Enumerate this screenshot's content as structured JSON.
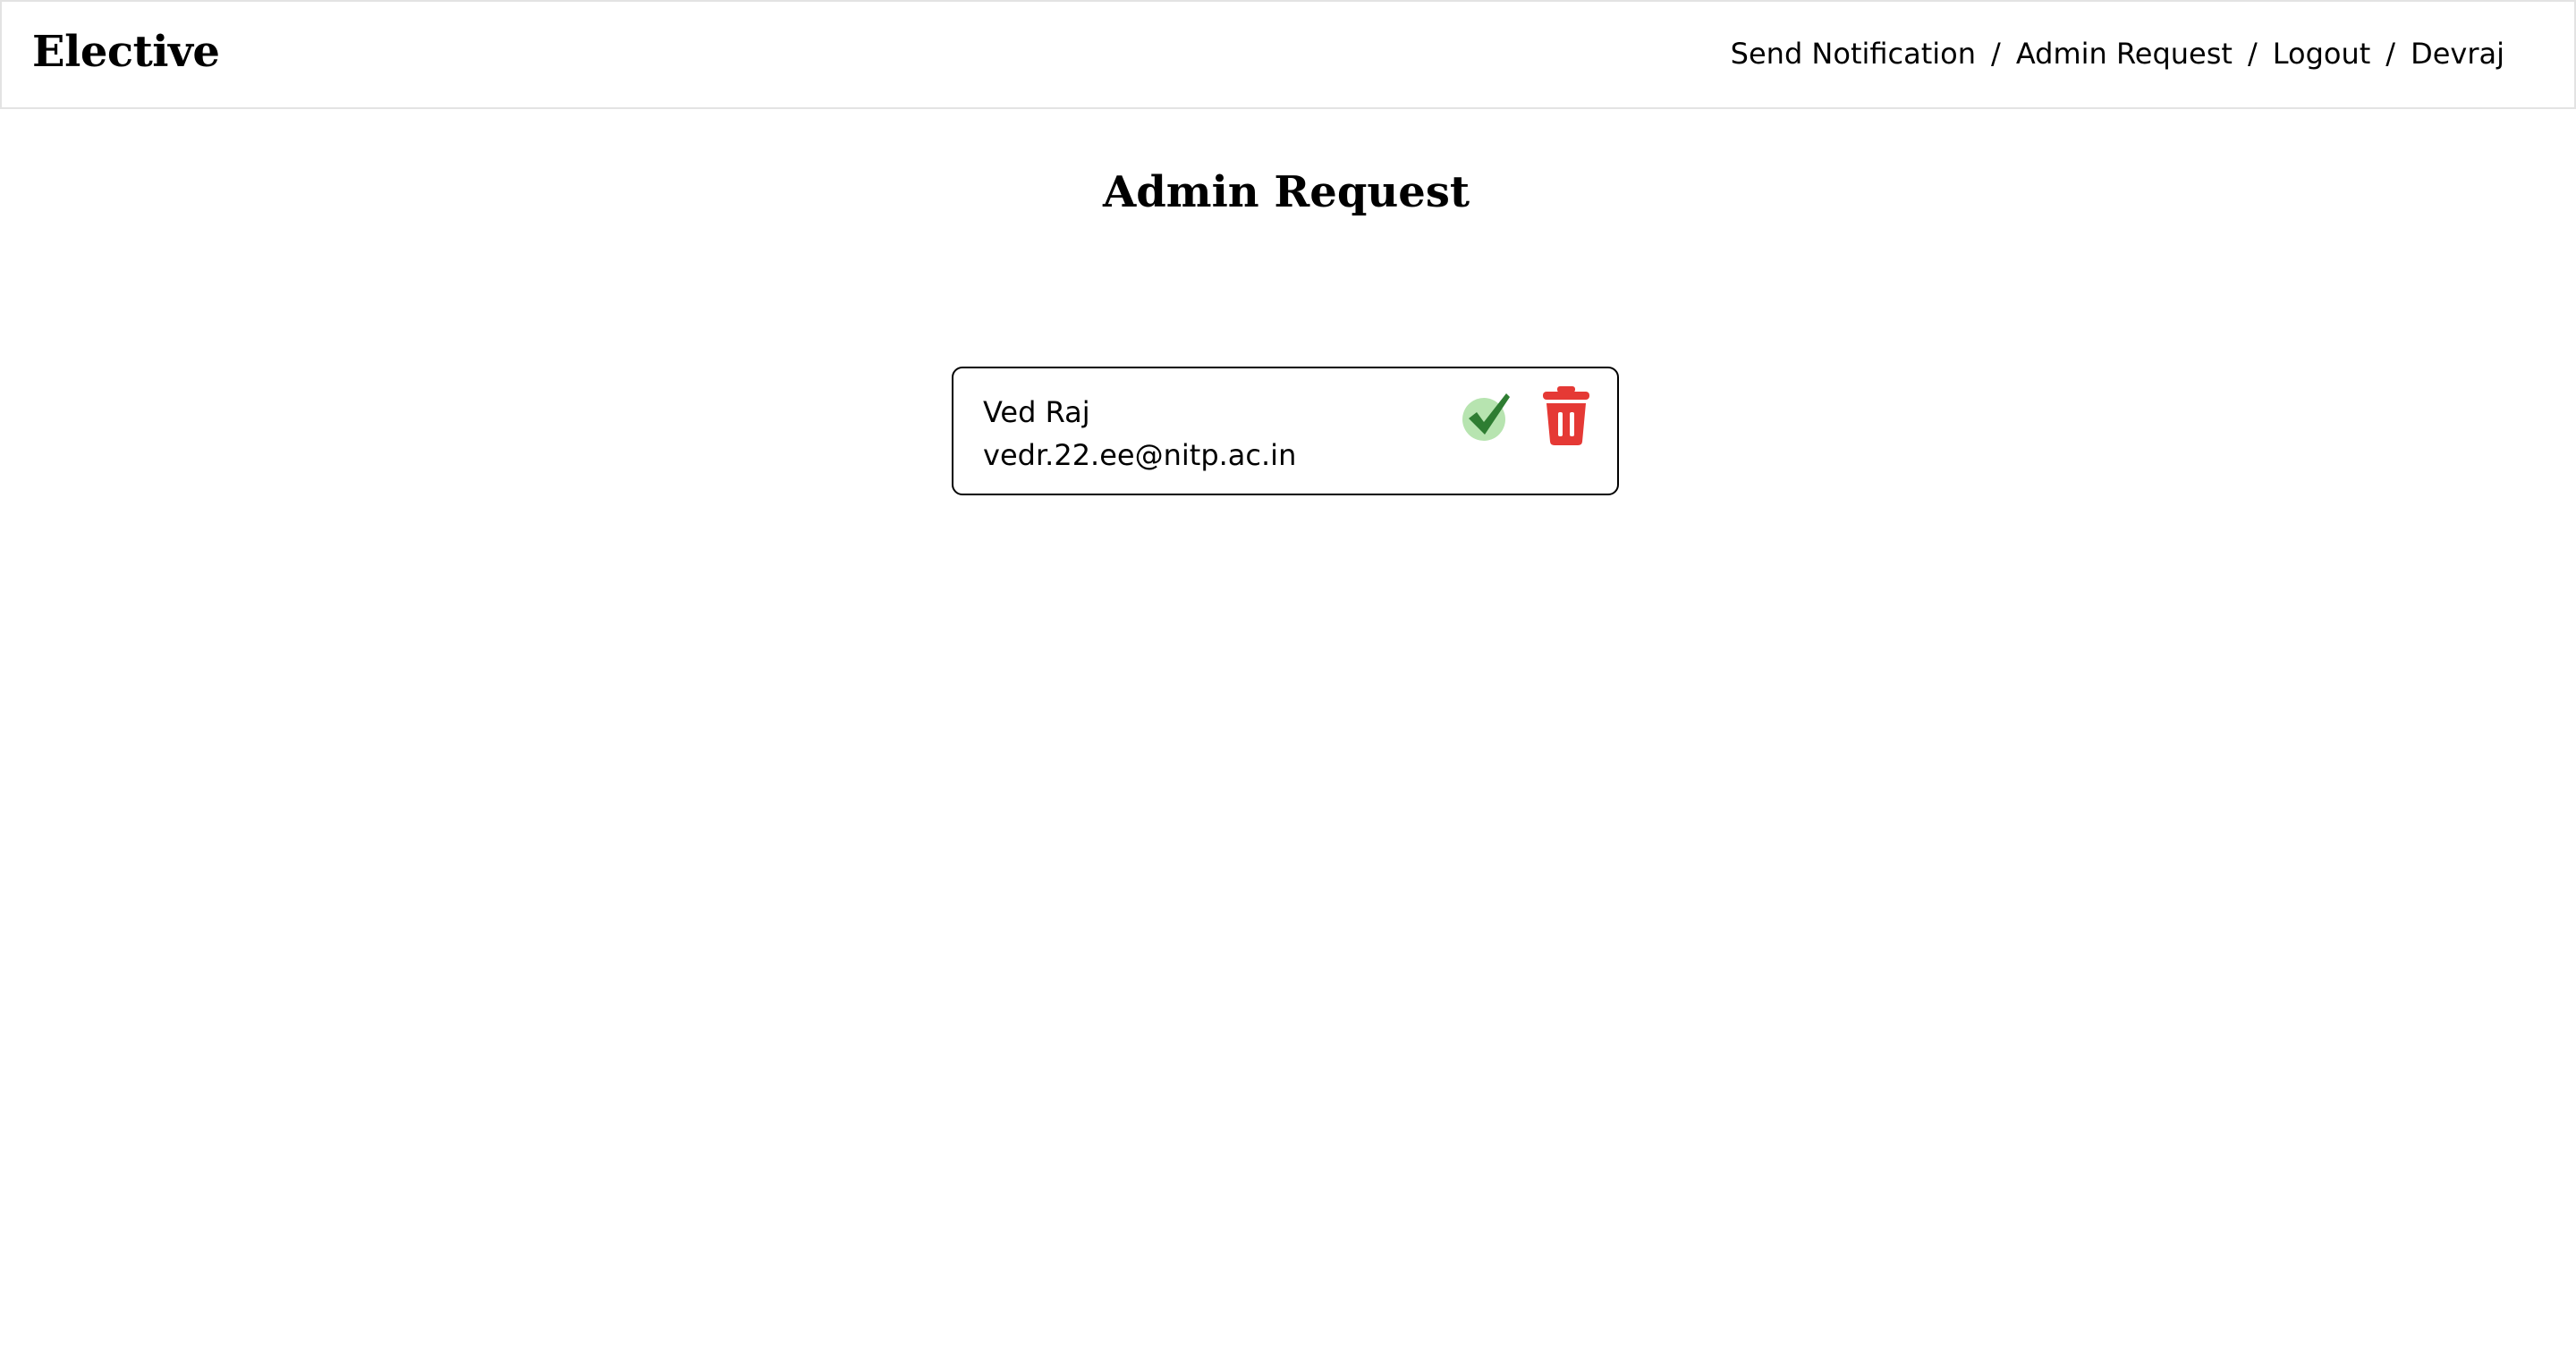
{
  "app": {
    "brand": "Elective"
  },
  "nav": {
    "items": [
      {
        "label": "Send Notification"
      },
      {
        "label": "Admin Request"
      },
      {
        "label": "Logout"
      },
      {
        "label": "Devraj"
      }
    ],
    "separator": "/"
  },
  "page": {
    "title": "Admin Request"
  },
  "requests": [
    {
      "name": "Ved Raj",
      "email": "vedr.22.ee@nitp.ac.in",
      "approve_icon": "check-icon",
      "delete_icon": "trash-icon"
    }
  ],
  "colors": {
    "approve_green": "#2e7d32",
    "approve_light": "#a5d6a7",
    "delete_red": "#e53935",
    "card_border": "#000000",
    "navbar_border": "#e3e3e3"
  }
}
